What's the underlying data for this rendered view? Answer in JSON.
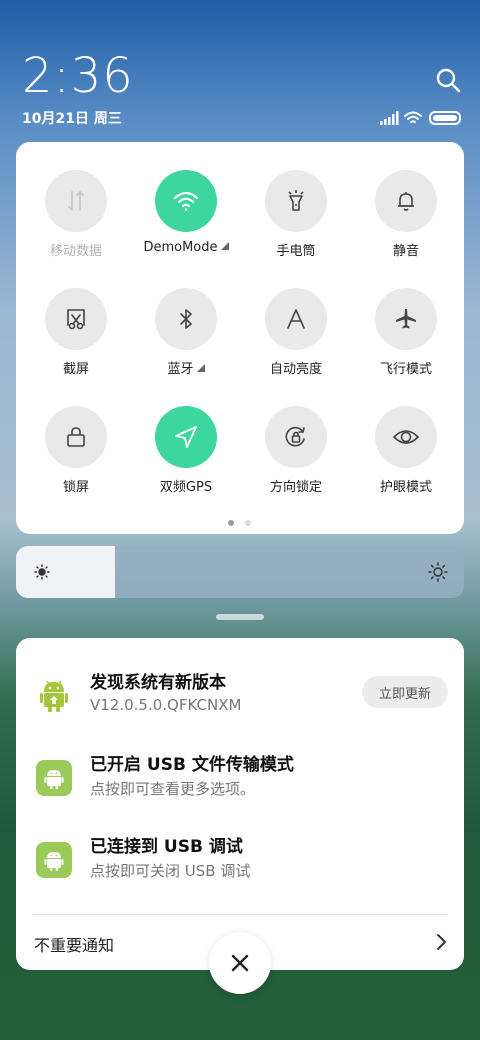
{
  "status_bar": {
    "time": "2:36",
    "date": "10月21日 周三",
    "icons": [
      "signal-icon",
      "wifi-icon",
      "battery-icon"
    ]
  },
  "quick_settings": {
    "accent_color": "#3ed69f",
    "tiles": [
      {
        "label": "移动数据",
        "icon": "mobile-data-icon",
        "state": "disabled"
      },
      {
        "label": "DemoMode",
        "icon": "wifi-icon",
        "state": "on",
        "expandable": true
      },
      {
        "label": "手电筒",
        "icon": "flashlight-icon",
        "state": "off"
      },
      {
        "label": "静音",
        "icon": "bell-icon",
        "state": "off"
      },
      {
        "label": "截屏",
        "icon": "screenshot-icon",
        "state": "off"
      },
      {
        "label": "蓝牙",
        "icon": "bluetooth-icon",
        "state": "off",
        "expandable": true
      },
      {
        "label": "自动亮度",
        "icon": "auto-brightness-icon",
        "state": "off"
      },
      {
        "label": "飞行模式",
        "icon": "airplane-icon",
        "state": "off"
      },
      {
        "label": "锁屏",
        "icon": "lock-icon",
        "state": "off"
      },
      {
        "label": "双频GPS",
        "icon": "gps-icon",
        "state": "on"
      },
      {
        "label": "方向锁定",
        "icon": "rotation-lock-icon",
        "state": "off"
      },
      {
        "label": "护眼模式",
        "icon": "eye-icon",
        "state": "off"
      }
    ],
    "pages": {
      "count": 2,
      "current": 1
    }
  },
  "brightness": {
    "level": 0.22
  },
  "notifications": {
    "items": [
      {
        "title": "发现系统有新版本",
        "subtitle": "V12.0.5.0.QFKCNXM",
        "action": "立即更新",
        "icon": "android-update-icon"
      },
      {
        "title": "已开启 USB 文件传输模式",
        "subtitle": "点按即可查看更多选项。",
        "icon": "android-icon"
      },
      {
        "title": "已连接到 USB 调试",
        "subtitle": "点按即可关闭 USB 调试",
        "icon": "android-icon"
      }
    ],
    "footer": "不重要通知"
  }
}
